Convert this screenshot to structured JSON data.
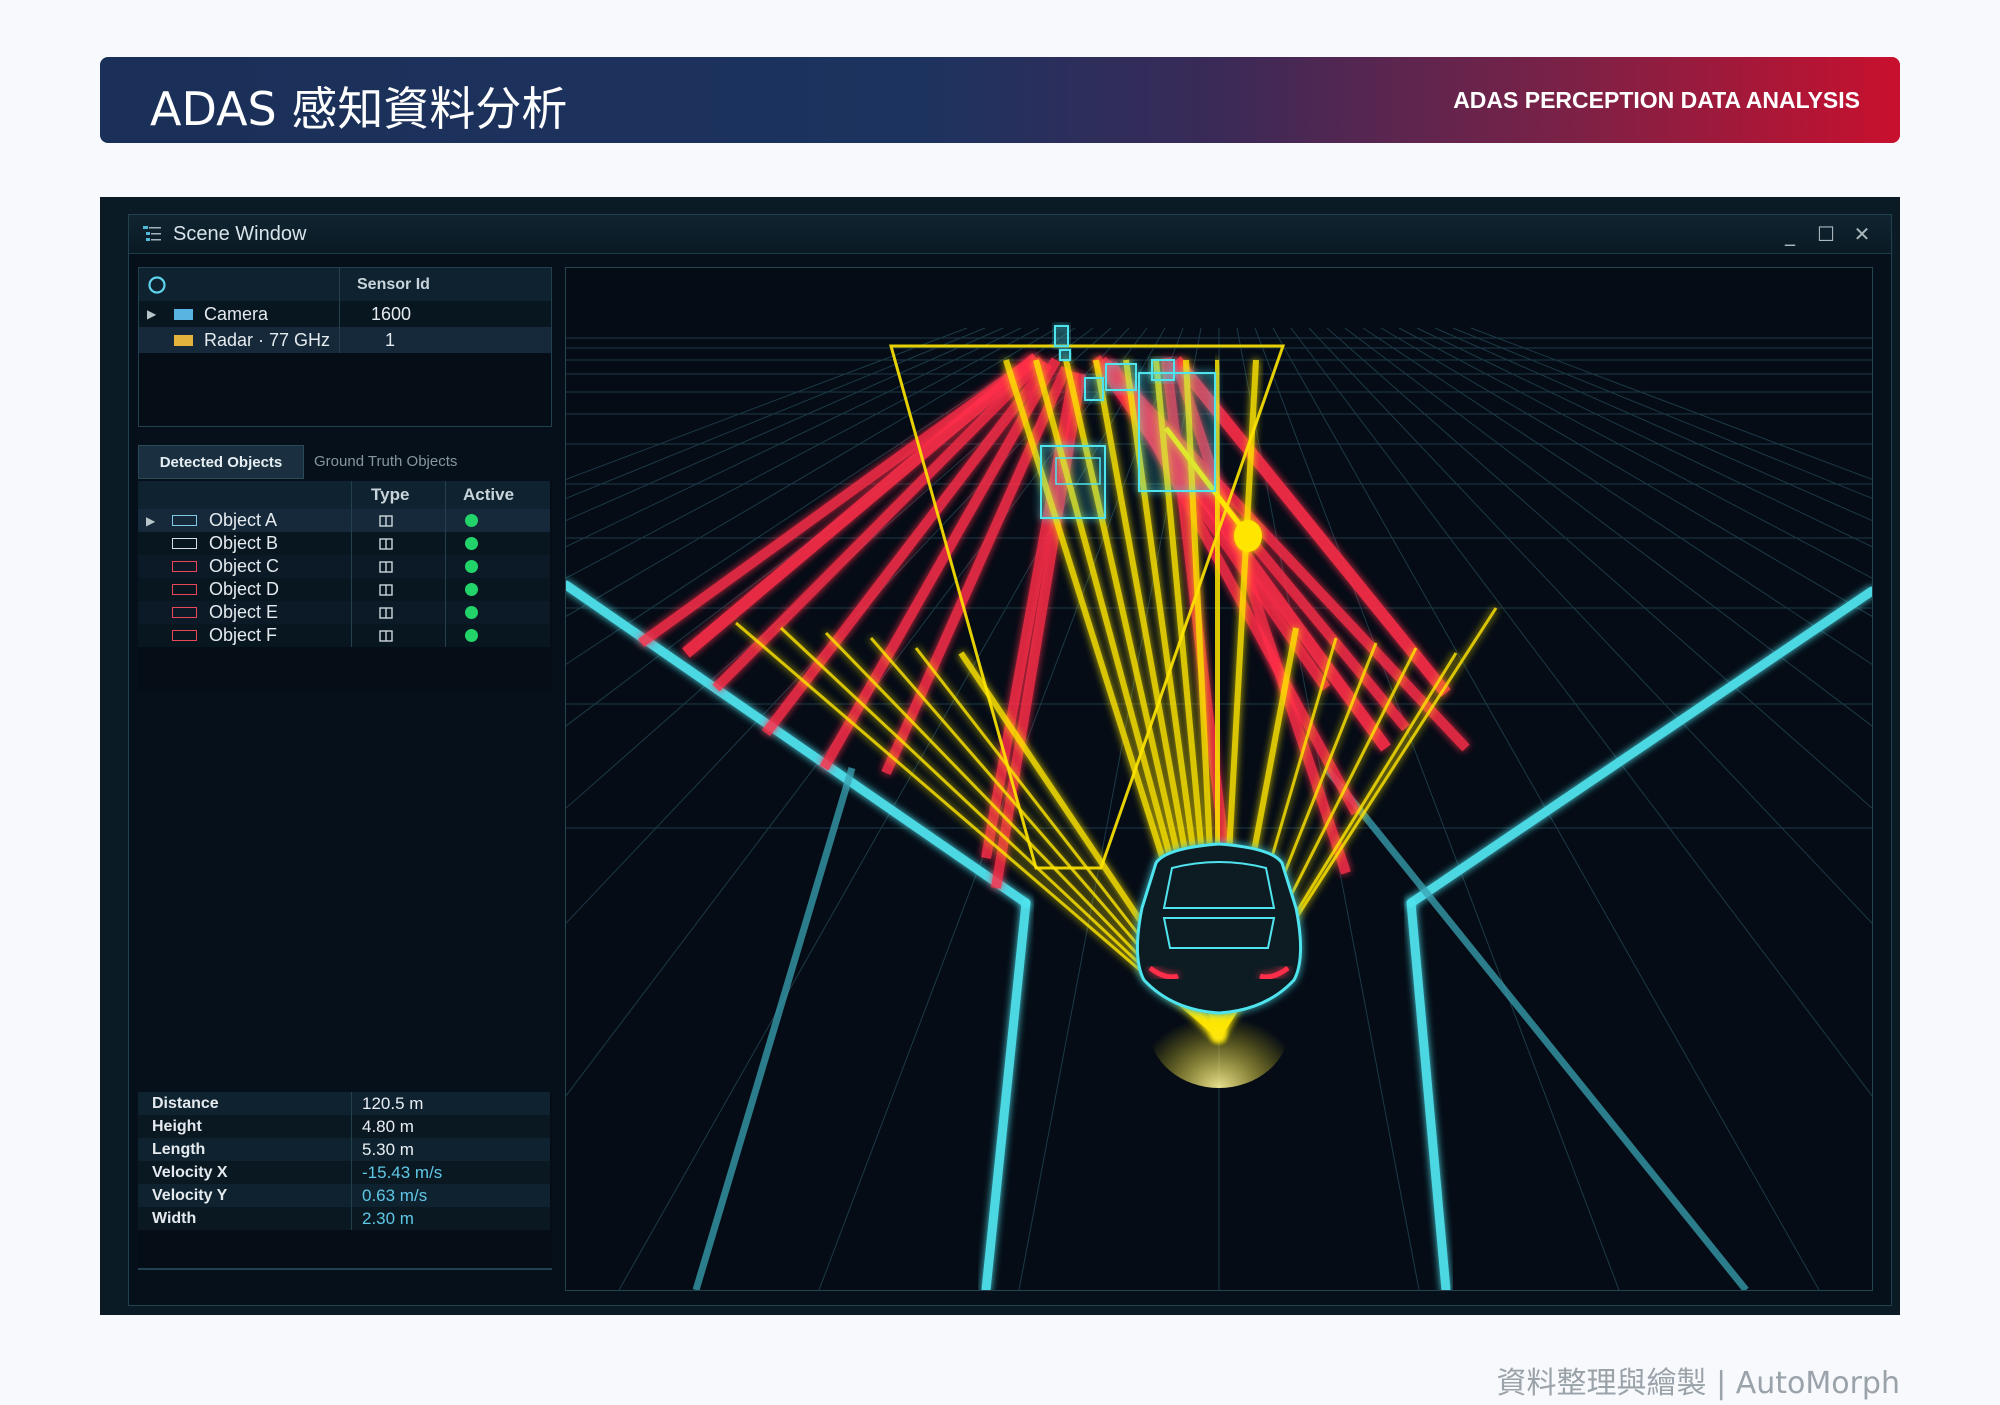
{
  "banner": {
    "title": "ADAS 感知資料分析",
    "subtitle": "ADAS PERCEPTION DATA ANALYSIS"
  },
  "window": {
    "title": "Scene Window",
    "controls": {
      "minimize": "_",
      "maximize": "☐",
      "close": "✕"
    }
  },
  "sensors": {
    "header_id": "Sensor Id",
    "rows": [
      {
        "name": "Camera",
        "id": "1600",
        "color": "#58b4e0"
      },
      {
        "name": "Radar · 77 GHz",
        "id": "1",
        "color": "#e2b43c"
      }
    ]
  },
  "tabs": {
    "active": "Detected Objects",
    "inactive": "Ground Truth Objects"
  },
  "objects": {
    "header_type": "Type",
    "header_active": "Active",
    "rows": [
      {
        "name": "Object A",
        "box_color": "#7fc8e6"
      },
      {
        "name": "Object B",
        "box_color": "#d8dde2"
      },
      {
        "name": "Object C",
        "box_color": "#e8475a"
      },
      {
        "name": "Object D",
        "box_color": "#e8475a"
      },
      {
        "name": "Object E",
        "box_color": "#e8475a"
      },
      {
        "name": "Object F",
        "box_color": "#e8475a"
      }
    ],
    "active_color": "#22d36a"
  },
  "properties": [
    {
      "label": "Distance",
      "value": "120.5 m",
      "color": "#e8eef2"
    },
    {
      "label": "Height",
      "value": "4.80 m",
      "color": "#e8eef2"
    },
    {
      "label": "Length",
      "value": "5.30 m",
      "color": "#e8eef2"
    },
    {
      "label": "Velocity X",
      "value": "-15.43 m/s",
      "color": "#5ec8e6"
    },
    {
      "label": "Velocity Y",
      "value": "0.63 m/s",
      "color": "#5ec8e6"
    },
    {
      "label": "Width",
      "value": "2.30 m",
      "color": "#5ec8e6"
    }
  ],
  "footer": "資料整理與繪製 | AutoMorph",
  "colors": {
    "cyan": "#4fe3ee",
    "yellow": "#ffe600",
    "red": "#ff2d48"
  }
}
